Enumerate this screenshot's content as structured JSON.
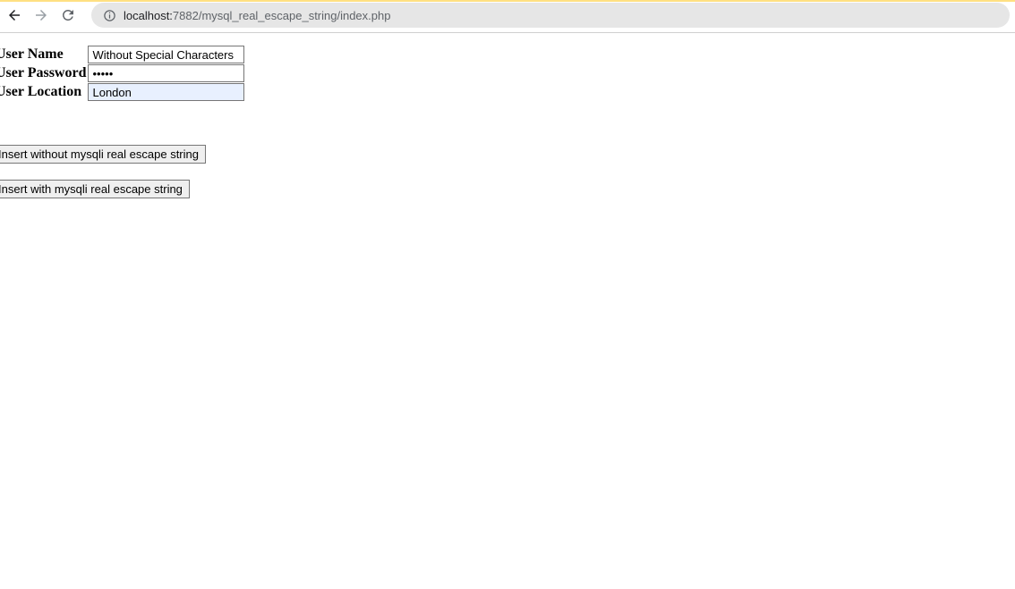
{
  "browser": {
    "url_host": "localhost:",
    "url_path": "7882/mysql_real_escape_string/index.php"
  },
  "form": {
    "labels": {
      "username": "User Name",
      "password": "User Password",
      "location": "User Location"
    },
    "values": {
      "username": "Without Special Characters",
      "password": "•••••",
      "location": "London"
    }
  },
  "buttons": {
    "insert_without": "Insert without mysqli real escape string",
    "insert_with": "Insert with mysqli real escape string"
  }
}
